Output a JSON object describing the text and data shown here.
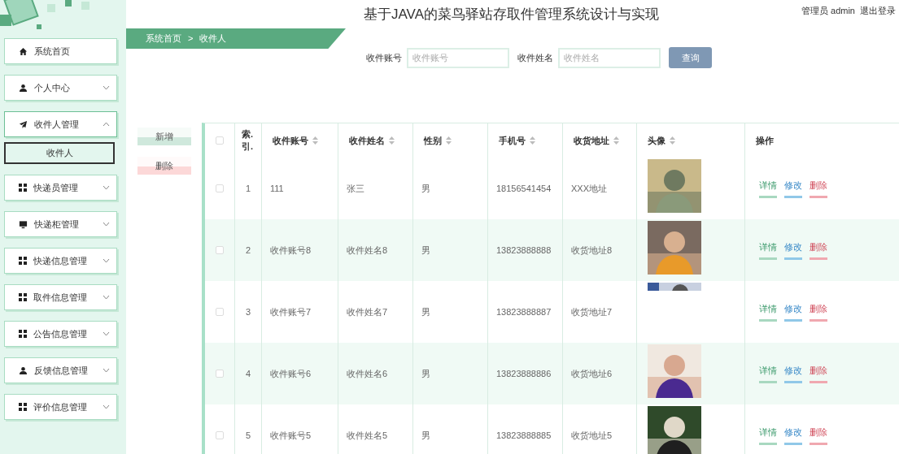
{
  "header": {
    "title": "基于JAVA的菜鸟驿站存取件管理系统设计与实现",
    "user": "管理员 admin",
    "logout": "退出登录"
  },
  "breadcrumb": [
    "系统首页",
    ">",
    "收件人"
  ],
  "sidebar": {
    "items": [
      {
        "label": "系统首页",
        "expanded": false,
        "has_caret": false
      },
      {
        "label": "个人中心",
        "expanded": false,
        "has_caret": true
      },
      {
        "label": "收件人管理",
        "expanded": true,
        "has_caret": true,
        "children": [
          {
            "label": "收件人",
            "selected": true
          }
        ]
      },
      {
        "label": "快递员管理",
        "expanded": false,
        "has_caret": true
      },
      {
        "label": "快递柜管理",
        "expanded": false,
        "has_caret": true
      },
      {
        "label": "快递信息管理",
        "expanded": false,
        "has_caret": true
      },
      {
        "label": "取件信息管理",
        "expanded": false,
        "has_caret": true
      },
      {
        "label": "公告信息管理",
        "expanded": false,
        "has_caret": true
      },
      {
        "label": "反馈信息管理",
        "expanded": false,
        "has_caret": true
      },
      {
        "label": "评价信息管理",
        "expanded": false,
        "has_caret": true
      }
    ]
  },
  "search": {
    "fields": [
      {
        "label": "收件账号",
        "placeholder": "收件账号"
      },
      {
        "label": "收件姓名",
        "placeholder": "收件姓名"
      }
    ],
    "button": "查询"
  },
  "actions": [
    {
      "label": "新增",
      "kind": "add"
    },
    {
      "label": "删除",
      "kind": "delete"
    }
  ],
  "table": {
    "columns": [
      {
        "label": "索.\n引."
      },
      {
        "label": "收件账号",
        "sortable": true
      },
      {
        "label": "收件姓名",
        "sortable": true
      },
      {
        "label": "性别",
        "sortable": true
      },
      {
        "label": "手机号",
        "sortable": true
      },
      {
        "label": "收货地址",
        "sortable": true
      },
      {
        "label": "头像",
        "sortable": true
      },
      {
        "label": "操作",
        "sortable": false
      }
    ],
    "select_all": {
      "checked": false
    },
    "rows": [
      {
        "checked": false,
        "index": "1",
        "account": "111",
        "name": "张三",
        "gender": "男",
        "phone": "18156541454",
        "address": "XXX地址",
        "actions": [
          "详情",
          "修改",
          "删除"
        ]
      },
      {
        "checked": false,
        "index": "2",
        "account": "收件账号8",
        "name": "收件姓名8",
        "gender": "男",
        "phone": "13823888888",
        "address": "收货地址8",
        "actions": [
          "详情",
          "修改",
          "删除"
        ]
      },
      {
        "checked": false,
        "index": "3",
        "account": "收件账号7",
        "name": "收件姓名7",
        "gender": "男",
        "phone": "13823888887",
        "address": "收货地址7",
        "avatar": {
          "kind": "strip"
        },
        "actions": [
          "详情",
          "修改",
          "删除"
        ]
      },
      {
        "checked": false,
        "index": "4",
        "account": "收件账号6",
        "name": "收件姓名6",
        "gender": "男",
        "phone": "13823888886",
        "address": "收货地址6",
        "actions": [
          "详情",
          "修改",
          "删除"
        ]
      },
      {
        "checked": false,
        "index": "5",
        "account": "收件账号5",
        "name": "收件姓名5",
        "gender": "男",
        "phone": "13823888885",
        "address": "收货地址5",
        "actions": [
          "详情",
          "修改",
          "删除"
        ]
      }
    ]
  }
}
